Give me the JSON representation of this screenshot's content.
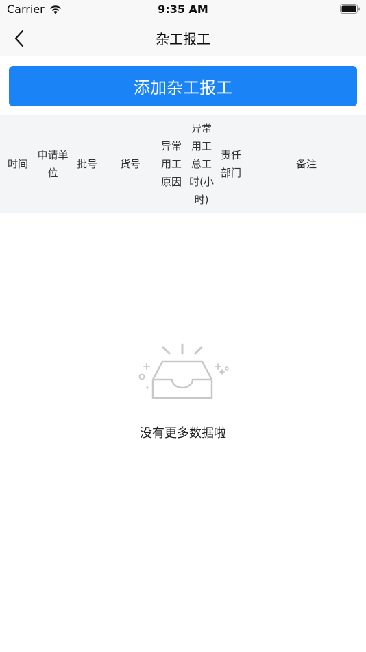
{
  "status_bar": {
    "carrier": "Carrier",
    "time": "9:35 AM"
  },
  "nav": {
    "title": "杂工报工",
    "back_icon": "chevron-left-icon"
  },
  "actions": {
    "add_label": "添加杂工报工"
  },
  "table": {
    "columns": [
      {
        "label": "时间"
      },
      {
        "label": "申请单位"
      },
      {
        "label": "批号"
      },
      {
        "label": "货号"
      },
      {
        "label": "异常用工原因"
      },
      {
        "label": "异常用工总工时(小时)"
      },
      {
        "label": "责任部门"
      },
      {
        "label": "备注"
      }
    ]
  },
  "empty_state": {
    "icon": "empty-inbox-icon",
    "message": "没有更多数据啦"
  },
  "colors": {
    "accent": "#1a84f7",
    "header_bg": "#f4f5f7",
    "bar_bg": "#f8f8f8"
  }
}
